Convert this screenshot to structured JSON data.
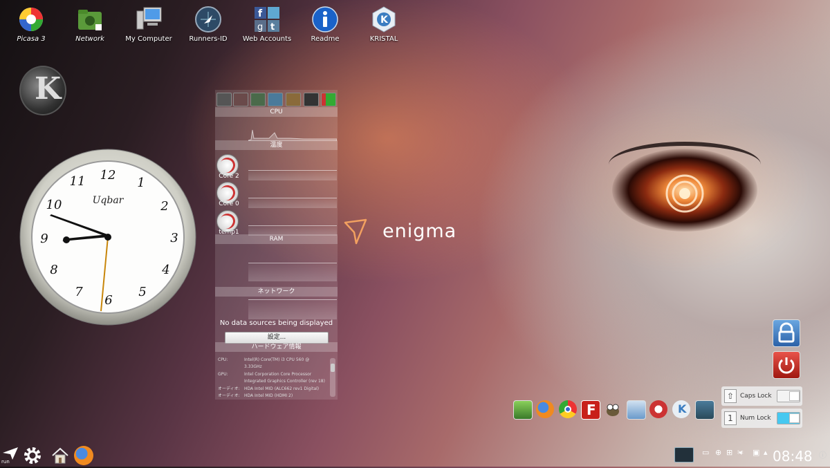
{
  "desktop_icons": [
    {
      "label": "Picasa 3"
    },
    {
      "label": "Network"
    },
    {
      "label": "My Computer"
    },
    {
      "label": "Runners-ID"
    },
    {
      "label": "Web Accounts"
    },
    {
      "label": "Readme"
    },
    {
      "label": "KRISTAL"
    }
  ],
  "clock": {
    "brand": "Uqbar",
    "numerals": [
      "12",
      "1",
      "2",
      "3",
      "4",
      "5",
      "6",
      "7",
      "8",
      "9",
      "10",
      "11"
    ]
  },
  "monitor": {
    "headers": {
      "cpu": "CPU",
      "temp": "温度",
      "ram": "RAM",
      "network": "ネットワーク",
      "hardware": "ハードウェア情報"
    },
    "gauges": [
      {
        "label": "Core 2"
      },
      {
        "label": "Core 0"
      },
      {
        "label": "temp1"
      }
    ],
    "no_data": "No data sources being displayed",
    "configure_button": "設定...",
    "hardware_rows": [
      {
        "key": "CPU:",
        "value": "Intel(R) Core(TM) i3 CPU 560 @"
      },
      {
        "key": "",
        "value": "3.33GHz"
      },
      {
        "key": "GPU:",
        "value": "Intel Corporation Core Processor"
      },
      {
        "key": "",
        "value": "Integrated Graphics Controller (rev 18)"
      },
      {
        "key": "オーディオ:",
        "value": "HDA Intel MID (ALC662 rev1 Digital)"
      },
      {
        "key": "オーディオ:",
        "value": "HDA Intel MID (HDMI 2)"
      }
    ]
  },
  "brand": {
    "name": "enigma"
  },
  "locks": [
    {
      "label": "Caps Lock",
      "state": "off"
    },
    {
      "label": "Num Lock",
      "state": "on"
    }
  ],
  "launcher": {
    "run_label": "run"
  },
  "tray": {
    "time": "08:48"
  },
  "colors": {
    "accent_blue": "#4f8fcf",
    "power_red": "#c8201a",
    "numlock_on": "#46c8f0"
  }
}
